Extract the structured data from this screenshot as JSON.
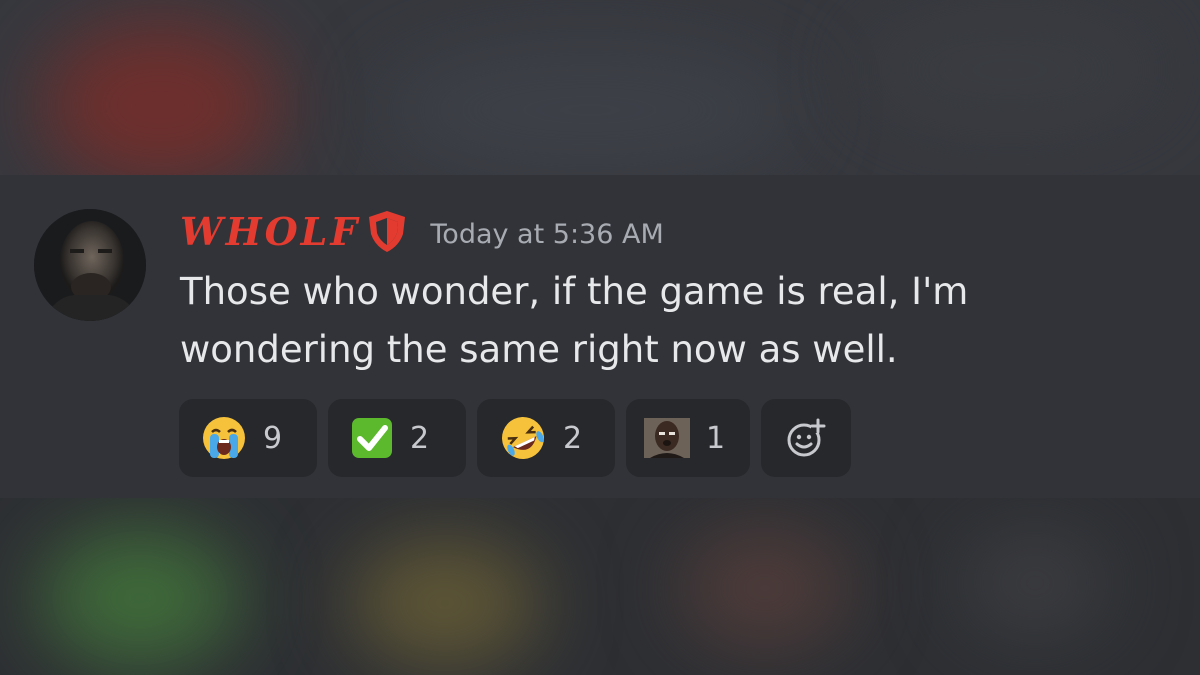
{
  "message": {
    "username": "WHOLF",
    "timestamp": "Today at 5:36 AM",
    "content": "Those who wonder, if the game is real, I'm wondering the same right now as well."
  },
  "reactions": [
    {
      "emoji": "loudly-crying-face",
      "count": "9"
    },
    {
      "emoji": "white-check-mark",
      "count": "2"
    },
    {
      "emoji": "rolling-on-the-floor-laughing",
      "count": "2"
    },
    {
      "emoji": "custom-face-emoji",
      "count": "1"
    },
    {
      "emoji": "add-reaction-icon"
    }
  ],
  "colors": {
    "username": "#e33b2f",
    "background": "#313338",
    "reaction_bg": "#26282c",
    "text": "#e6e8ea",
    "muted": "#a8abb2"
  }
}
